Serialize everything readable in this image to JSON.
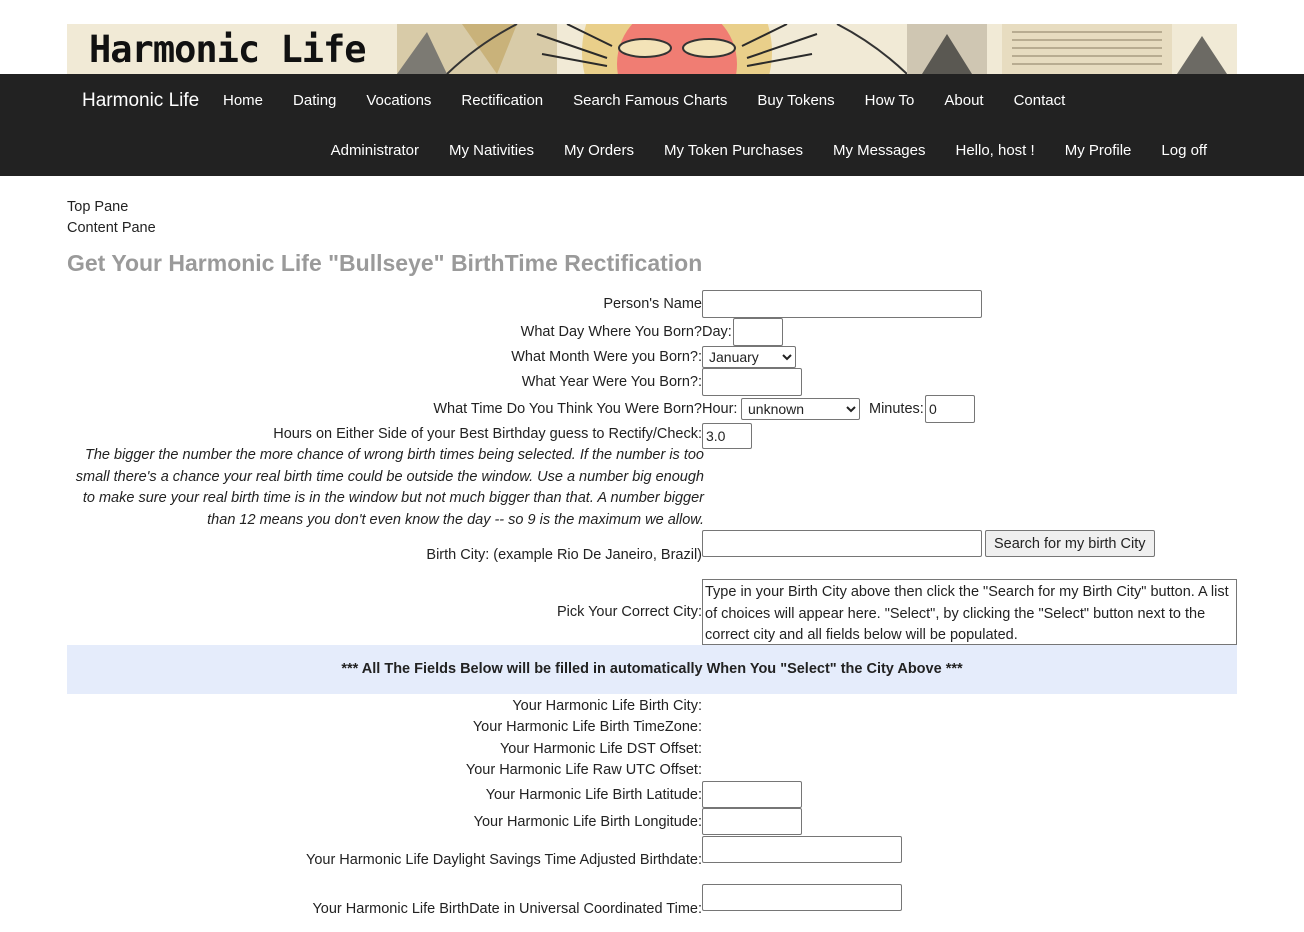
{
  "banner": {
    "logo_text": "Harmonic Life"
  },
  "nav": {
    "brand": "Harmonic Life",
    "primary": [
      "Home",
      "Dating",
      "Vocations",
      "Rectification",
      "Search Famous Charts",
      "Buy Tokens",
      "How To",
      "About",
      "Contact"
    ],
    "secondary": [
      "Administrator",
      "My Nativities",
      "My Orders",
      "My Token Purchases",
      "My Messages",
      "Hello, host !",
      "My Profile",
      "Log off"
    ]
  },
  "panes": {
    "top": "Top Pane",
    "content": "Content Pane"
  },
  "title": "Get Your Harmonic Life \"Bullseye\" BirthTime Rectification",
  "form": {
    "name_label": "Person's Name",
    "name_value": "",
    "day_label": "What Day Where You Born?",
    "day_prefix": "Day:",
    "day_value": "",
    "month_label": "What Month Were you Born?:",
    "month_value": "January",
    "year_label": "What Year Were You Born?:",
    "year_value": "",
    "time_label": "What Time Do You Think You Were Born?",
    "hour_prefix": "Hour:",
    "hour_value": "unknown",
    "minutes_prefix": "Minutes:",
    "minutes_value": "0",
    "hours_label": "Hours on Either Side of your Best Birthday guess to Rectify/Check:",
    "hours_value": "3.0",
    "hours_help": "The bigger the number the more chance of wrong birth times being selected. If the number is too small there's a chance your real birth time could be outside the window. Use a number big enough to make sure your real birth time is in the window but not much bigger than that. A number bigger than 12 means you don't even know the day -- so 9 is the maximum we allow.",
    "city_label": "Birth City: (example Rio De Janeiro, Brazil)",
    "city_value": "",
    "search_button": "Search for my birth City",
    "pick_label": "Pick Your Correct City:",
    "pick_text": "Type in your Birth City above then click the \"Search for my Birth City\" button. A list of choices will appear here. \"Select\", by clicking the \"Select\" button next to the correct city and all fields below will be populated."
  },
  "notice": "*** All The Fields Below will be filled in automatically When You \"Select\" the City Above ***",
  "auto": {
    "birth_city_label": "Your Harmonic Life Birth City:",
    "timezone_label": "Your Harmonic Life Birth TimeZone:",
    "dst_label": "Your Harmonic Life DST Offset:",
    "utc_label": "Your Harmonic Life Raw UTC Offset:",
    "latitude_label": "Your Harmonic Life Birth Latitude:",
    "latitude_value": "",
    "longitude_label": "Your Harmonic Life Birth Longitude:",
    "longitude_value": "",
    "dst_birthdate_label": "Your Harmonic Life Daylight Savings Time Adjusted Birthdate:",
    "dst_birthdate_value": "",
    "utc_birthdate_label": "Your Harmonic Life BirthDate in Universal Coordinated Time:",
    "utc_birthdate_value": ""
  }
}
